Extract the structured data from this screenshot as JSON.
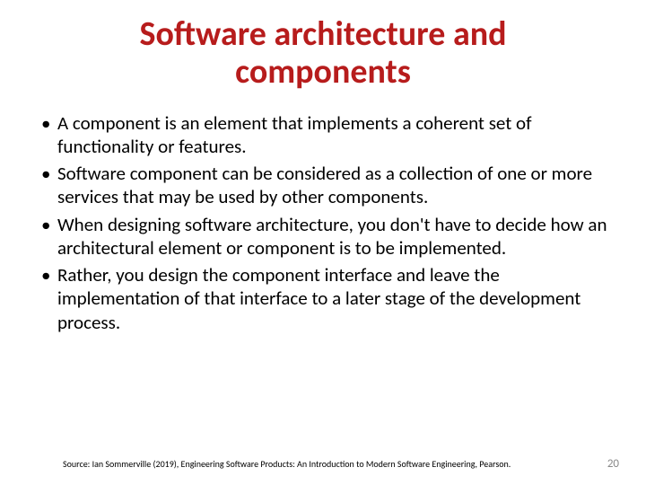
{
  "title": "Software architecture and components",
  "bullets": [
    "A component is an element that implements a coherent set of functionality or features.",
    "Software component can be considered as a collection of one or more services that may be used by other components.",
    "When designing software architecture, you don't have to decide how an architectural element or component is to be implemented.",
    "Rather, you design the component interface and leave the implementation of that interface to a later stage of the development process."
  ],
  "source": "Source: Ian Sommerville (2019), Engineering Software Products:  An Introduction to Modern Software Engineering, Pearson.",
  "page_number": "20"
}
